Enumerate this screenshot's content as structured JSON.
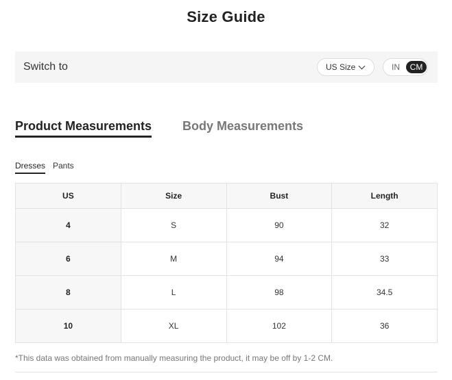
{
  "title": "Size Guide",
  "switch_bar": {
    "label": "Switch to",
    "size_select": {
      "value": "US Size"
    },
    "unit_toggle": {
      "in_label": "IN",
      "cm_label": "CM",
      "active": "CM"
    }
  },
  "tabs": [
    {
      "label": "Product Measurements",
      "active": true
    },
    {
      "label": "Body Measurements",
      "active": false
    }
  ],
  "subtabs": [
    {
      "label": "Dresses",
      "active": true
    },
    {
      "label": "Pants",
      "active": false
    }
  ],
  "table": {
    "headers": [
      "US",
      "Size",
      "Bust",
      "Length"
    ],
    "rows": [
      [
        "4",
        "S",
        "90",
        "32"
      ],
      [
        "6",
        "M",
        "94",
        "33"
      ],
      [
        "8",
        "L",
        "98",
        "34.5"
      ],
      [
        "10",
        "XL",
        "102",
        "36"
      ]
    ]
  },
  "note": "*This data was obtained from manually measuring the product, it may be off by 1-2 CM."
}
